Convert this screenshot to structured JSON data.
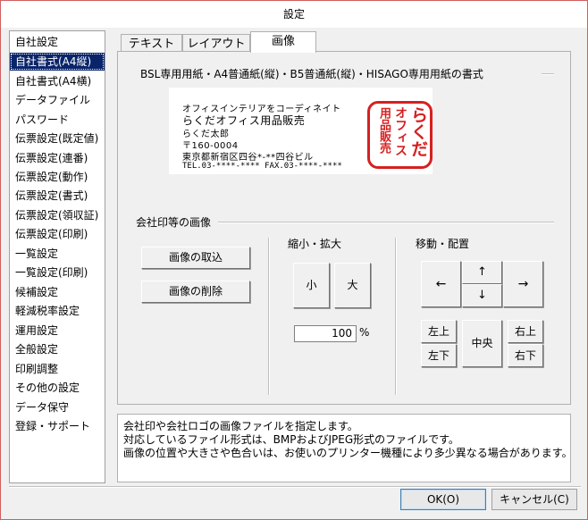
{
  "window": {
    "title": "設定"
  },
  "sidebar": {
    "items": [
      {
        "label": "自社設定"
      },
      {
        "label": "自社書式(A4縦)",
        "selected": true
      },
      {
        "label": "自社書式(A4横)"
      },
      {
        "label": "データファイル"
      },
      {
        "label": "パスワード"
      },
      {
        "label": "伝票設定(既定値)"
      },
      {
        "label": "伝票設定(連番)"
      },
      {
        "label": "伝票設定(動作)"
      },
      {
        "label": "伝票設定(書式)"
      },
      {
        "label": "伝票設定(領収証)"
      },
      {
        "label": "伝票設定(印刷)"
      },
      {
        "label": "一覧設定"
      },
      {
        "label": "一覧設定(印刷)"
      },
      {
        "label": "候補設定"
      },
      {
        "label": "軽減税率設定"
      },
      {
        "label": "運用設定"
      },
      {
        "label": "全般設定"
      },
      {
        "label": "印刷調整"
      },
      {
        "label": "その他の設定"
      },
      {
        "label": "データ保守"
      },
      {
        "label": "登録・サポート"
      }
    ]
  },
  "tabs": [
    {
      "label": "テキスト"
    },
    {
      "label": "レイアウト"
    },
    {
      "label": "画像",
      "active": true
    }
  ],
  "preview_section": {
    "title": "BSL専用用紙・A4普通紙(縦)・B5普通紙(縦)・HISAGO専用用紙の書式",
    "lines": [
      "オフィスインテリアをコーディネイト",
      "らくだオフィス用品販売",
      "らくだ太郎",
      "〒160-0004",
      "東京都新宿区四谷*-**四谷ビル",
      "TEL.03-****-****  FAX.03-****-****"
    ],
    "stamp": {
      "col1": "らくだ",
      "col2": "オフィス",
      "col3": "用品販売",
      "color": "#d62020"
    }
  },
  "image_section": {
    "title": "会社印等の画像",
    "import_button": "画像の取込",
    "delete_button": "画像の削除",
    "scale": {
      "title": "縮小・拡大",
      "shrink_button": "小",
      "enlarge_button": "大",
      "percent_value": "100",
      "percent_unit": "%"
    },
    "move": {
      "title": "移動・配置",
      "left_arrow": "←",
      "up_arrow": "↑",
      "down_arrow": "↓",
      "right_arrow": "→",
      "top_left": "左上",
      "bottom_left": "左下",
      "center": "中央",
      "top_right": "右上",
      "bottom_right": "右下"
    }
  },
  "info": {
    "lines": [
      "会社印や会社ロゴの画像ファイルを指定します。",
      "対応しているファイル形式は、BMPおよびJPEG形式のファイルです。",
      "画像の位置や大きさや色合いは、お使いのプリンター機種により多少異なる場合があります。"
    ]
  },
  "footer": {
    "ok_button": "OK(O)",
    "cancel_button": "キャンセル(C)"
  }
}
